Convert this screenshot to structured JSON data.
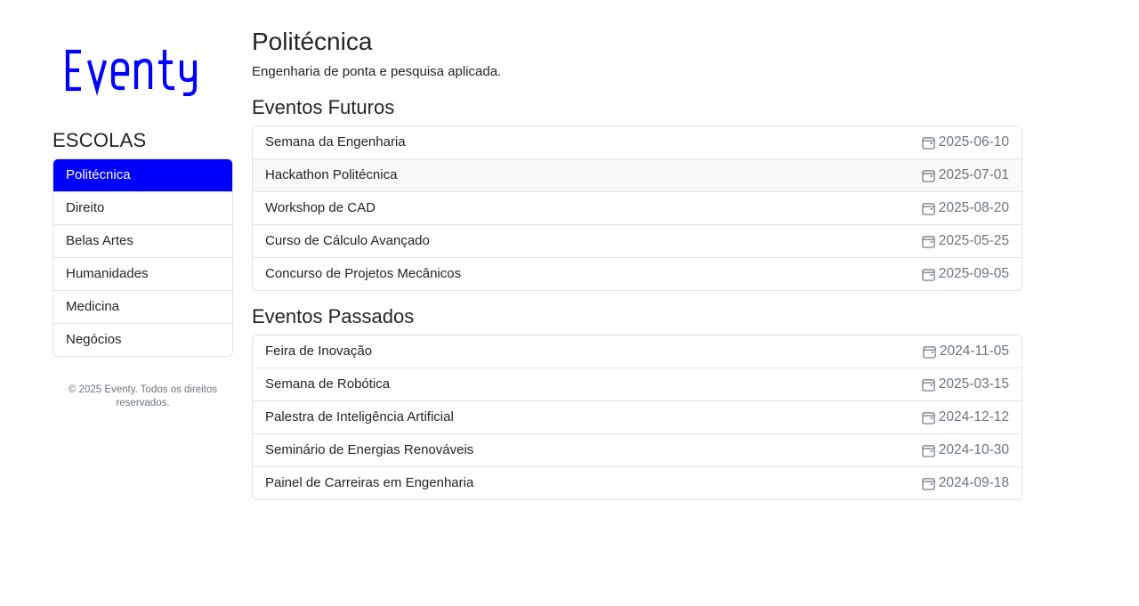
{
  "brand": {
    "logo_text": "Eventy",
    "accent_color": "#0000ff"
  },
  "sidebar": {
    "heading": "ESCOLAS",
    "items": [
      {
        "label": "Politécnica",
        "active": true
      },
      {
        "label": "Direito",
        "active": false
      },
      {
        "label": "Belas Artes",
        "active": false
      },
      {
        "label": "Humanidades",
        "active": false
      },
      {
        "label": "Medicina",
        "active": false
      },
      {
        "label": "Negócios",
        "active": false
      }
    ],
    "footer": "© 2025 Eventy. Todos os direitos reservados."
  },
  "main": {
    "title": "Politécnica",
    "subtitle": "Engenharia de ponta e pesquisa aplicada.",
    "upcoming": {
      "title": "Eventos Futuros",
      "events": [
        {
          "name": "Semana da Engenharia",
          "date": "2025-06-10"
        },
        {
          "name": "Hackathon Politécnica",
          "date": "2025-07-01"
        },
        {
          "name": "Workshop de CAD",
          "date": "2025-08-20"
        },
        {
          "name": "Curso de Cálculo Avançado",
          "date": "2025-05-25"
        },
        {
          "name": "Concurso de Projetos Mecânicos",
          "date": "2025-09-05"
        }
      ]
    },
    "past": {
      "title": "Eventos Passados",
      "events": [
        {
          "name": "Feira de Inovação",
          "date": "2024-11-05"
        },
        {
          "name": "Semana de Robótica",
          "date": "2025-03-15"
        },
        {
          "name": "Palestra de Inteligência Artificial",
          "date": "2024-12-12"
        },
        {
          "name": "Seminário de Energias Renováveis",
          "date": "2024-10-30"
        },
        {
          "name": "Painel de Carreiras em Engenharia",
          "date": "2024-09-18"
        }
      ]
    }
  },
  "icons": {
    "event_date": "calendar-icon"
  }
}
